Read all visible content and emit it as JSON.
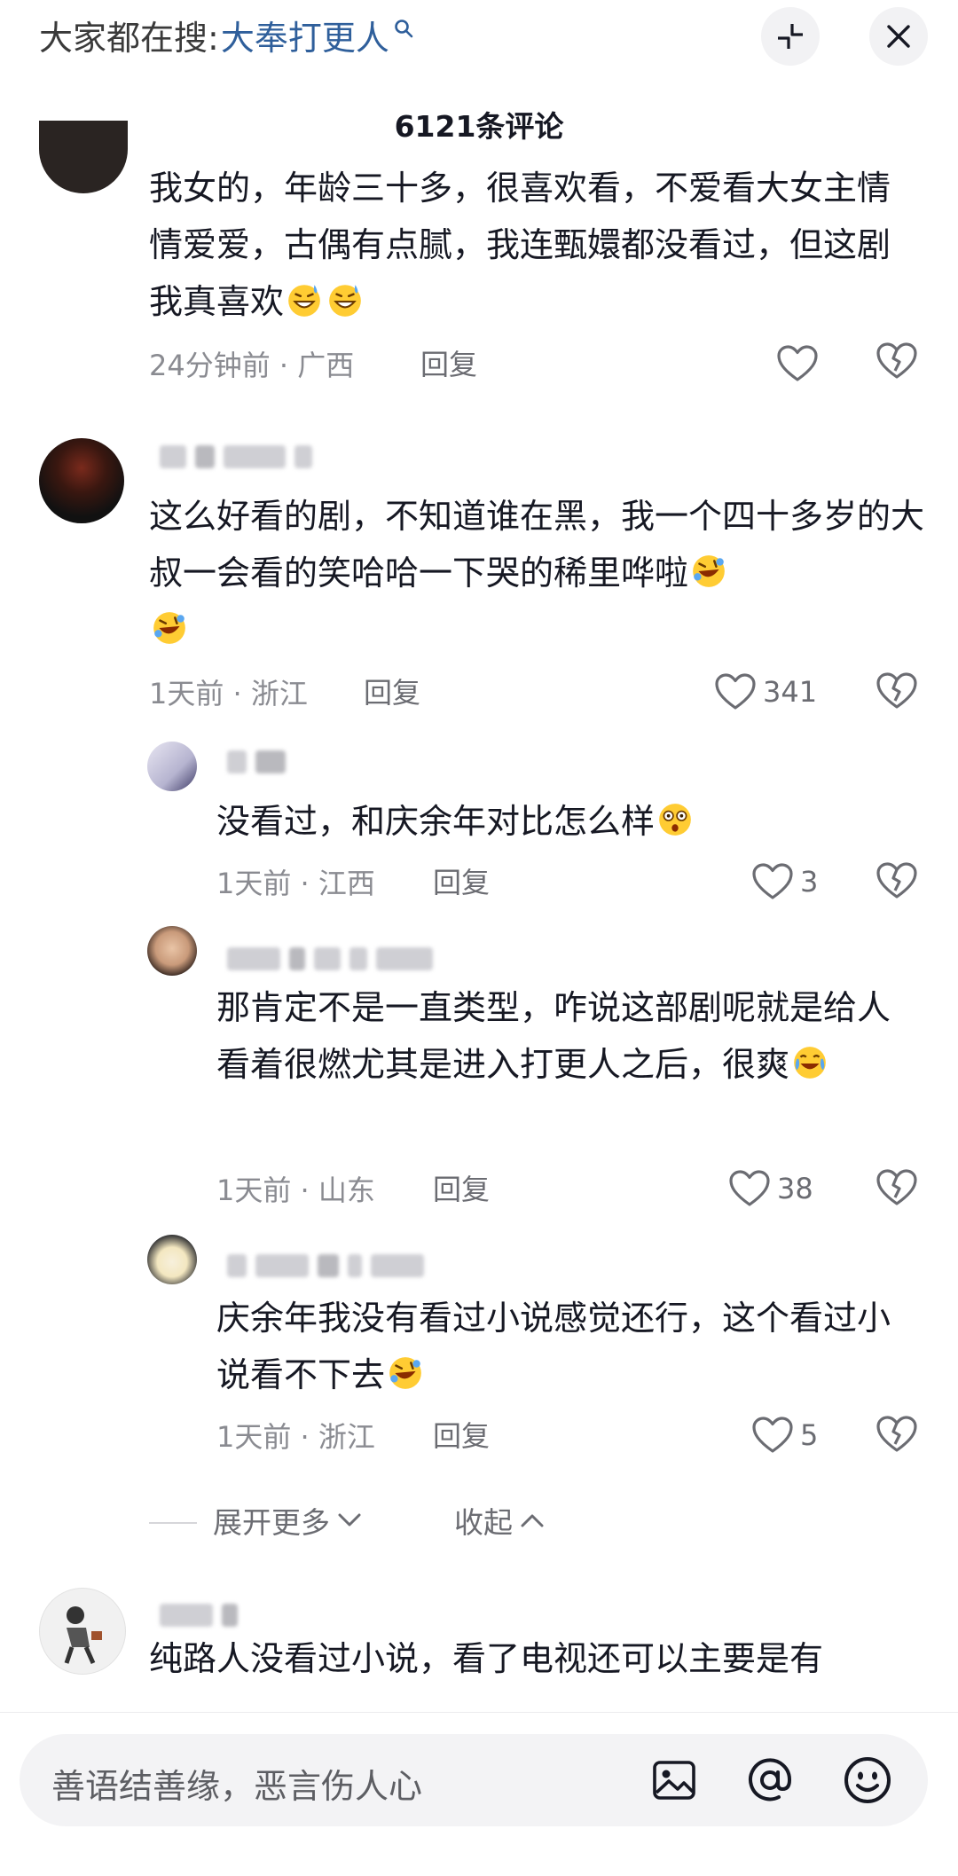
{
  "header": {
    "search_prefix": "大家都在搜:",
    "search_term": "大奉打更人",
    "comment_count": "6121条评论"
  },
  "icons": {
    "search": "search-icon",
    "collapse": "collapse-arrows-icon",
    "close": "close-icon",
    "like": "heart-outline-icon",
    "dislike": "broken-heart-icon",
    "image": "image-icon",
    "mention": "at-icon",
    "emoji": "smiley-icon"
  },
  "comments": [
    {
      "text": "我女的，年龄三十多，很喜欢看，不爱看大女主情情爱爱，古偶有点腻，我连甄嬛都没看过，但这剧我真喜欢",
      "time_location": "24分钟前 · 广西",
      "reply_label": "回复",
      "like_count": ""
    },
    {
      "text": "这么好看的剧，不知道谁在黑，我一个四十多岁的大叔一会看的笑哈哈一下哭的稀里哗啦",
      "time_location": "1天前 · 浙江",
      "reply_label": "回复",
      "like_count": "341"
    },
    {
      "text": "没看过，和庆余年对比怎么样",
      "time_location": "1天前 · 江西",
      "reply_label": "回复",
      "like_count": "3"
    },
    {
      "text": "那肯定不是一直类型，咋说这部剧呢就是给人看着很燃尤其是进入打更人之后，很爽",
      "time_location": "1天前 · 山东",
      "reply_label": "回复",
      "like_count": "38"
    },
    {
      "text": "庆余年我没有看过小说感觉还行，这个看过小说看不下去",
      "time_location": "1天前 · 浙江",
      "reply_label": "回复",
      "like_count": "5"
    },
    {
      "text": "纯路人没看过小说，看了电视还可以主要是有",
      "time_location": "",
      "reply_label": "",
      "like_count": ""
    }
  ],
  "expand": {
    "more_label": "展开更多",
    "collapse_label": "收起"
  },
  "input": {
    "placeholder": "善语结善缘，恶言伤人心"
  },
  "colors": {
    "accent_blue": "#2f5f9b",
    "text": "#161823",
    "muted": "#8a8b91"
  }
}
